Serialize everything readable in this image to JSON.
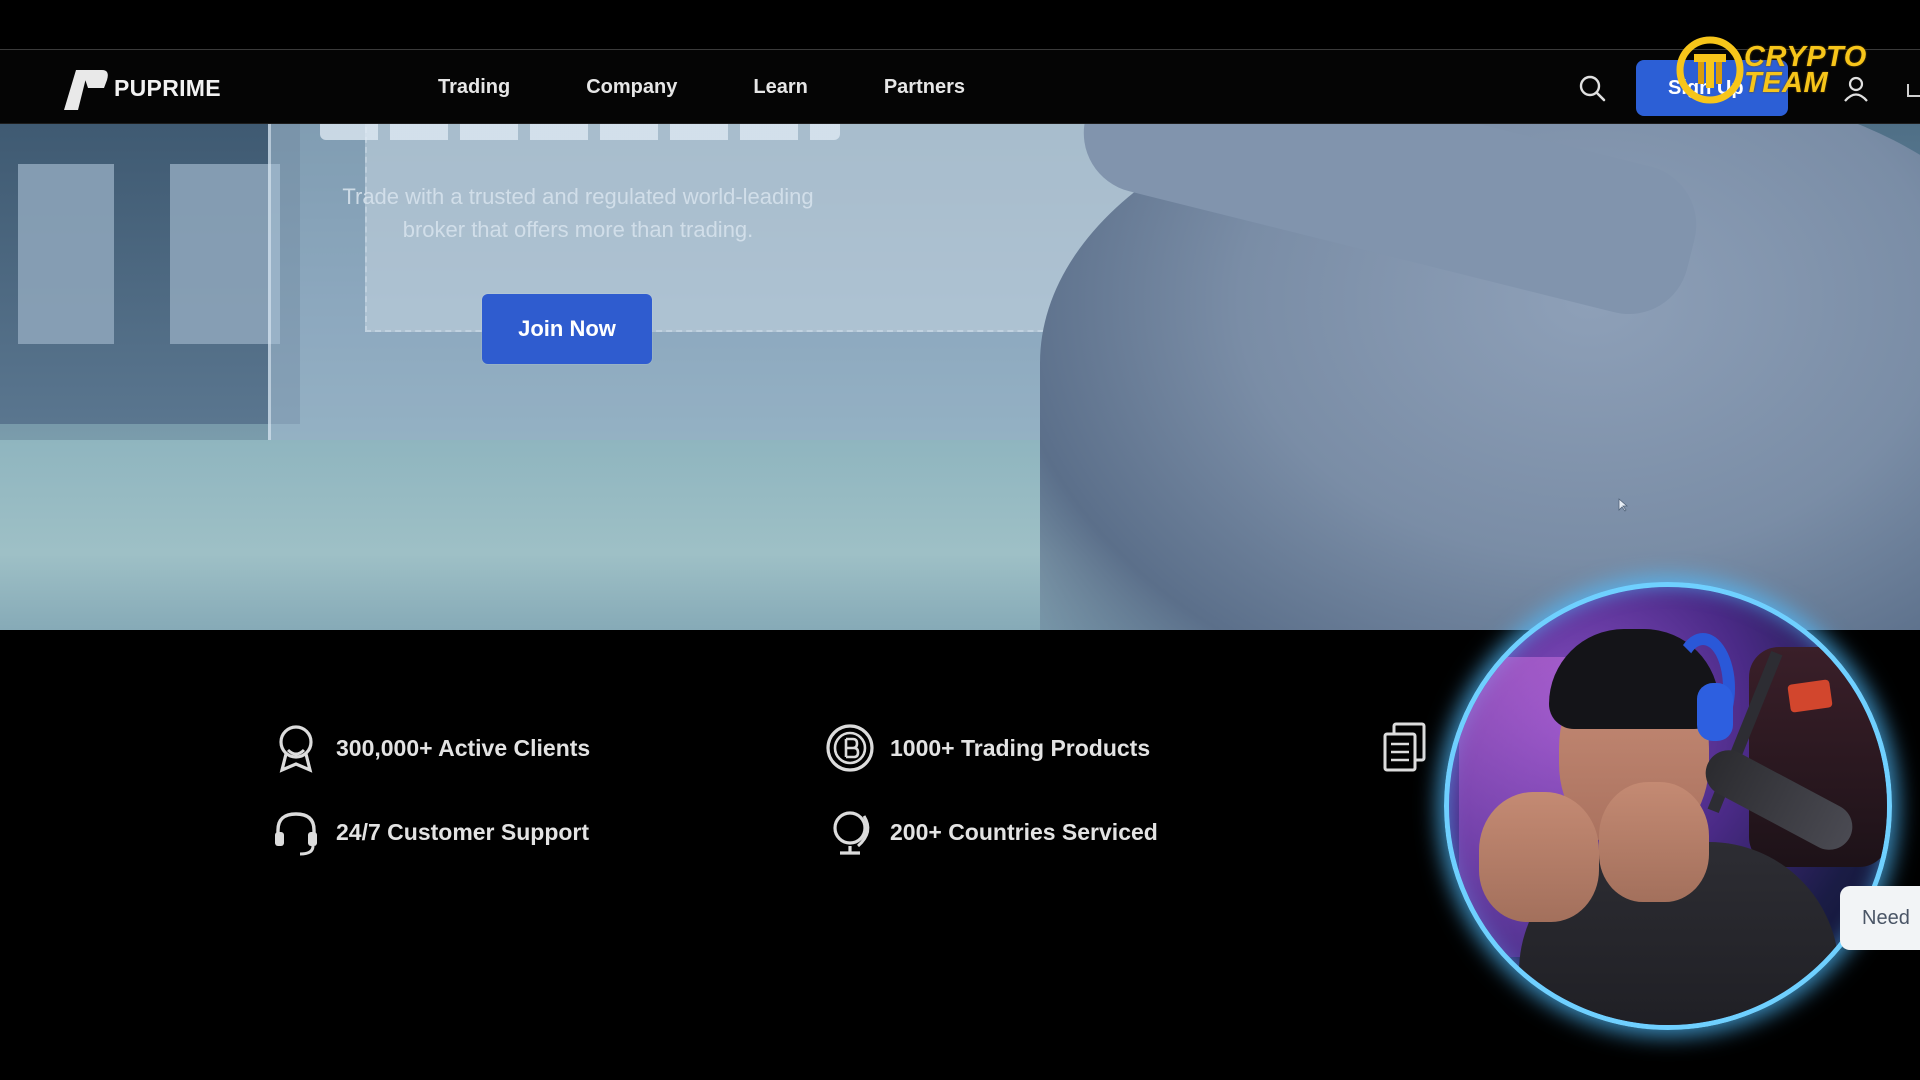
{
  "brand": {
    "logo_text": "PUPRIME"
  },
  "nav": {
    "items": [
      "Trading",
      "Company",
      "Learn",
      "Partners"
    ]
  },
  "header": {
    "signup_label": "Sign Up"
  },
  "overlay_badge": {
    "line1": "CRYPTO",
    "line2": "TEAM"
  },
  "hero": {
    "subtitle": "Trade with a trusted and regulated world-leading broker that offers more than trading.",
    "join_label": "Join Now"
  },
  "stats": [
    {
      "label": "300,000+ Active Clients",
      "icon": "award-icon"
    },
    {
      "label": "1000+ Trading Products",
      "icon": "bitcoin-coin-icon"
    },
    {
      "label": "24/7 Customer Support",
      "icon": "headset-icon"
    },
    {
      "label": "200+ Countries Serviced",
      "icon": "globe-icon"
    }
  ],
  "help_tab": {
    "label": "Need"
  },
  "colors": {
    "accent_blue": "#2f5ccf",
    "brand_gold": "#f7c51a",
    "webcam_glow": "#6fd0ff"
  }
}
